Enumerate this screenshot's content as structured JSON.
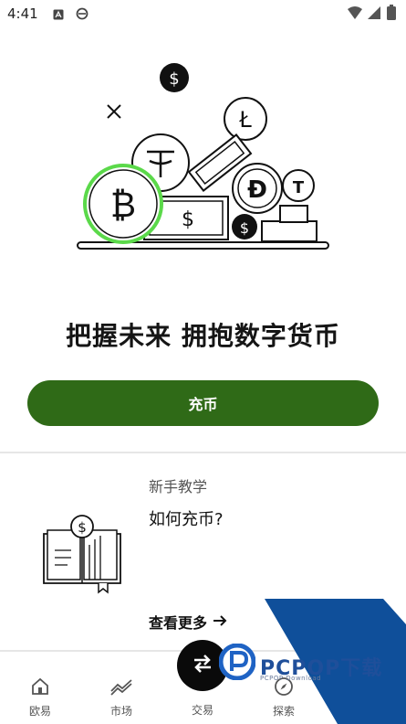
{
  "status_bar": {
    "time": "4:41",
    "icons": [
      "a-box-icon",
      "e-browser-icon",
      "wifi-icon",
      "signal-icon",
      "battery-icon"
    ]
  },
  "hero": {
    "illustration": "crypto-coins-illustration",
    "accent_color": "#5bd94a"
  },
  "headline": "把握未来 拥抱数字货币",
  "cta": {
    "label": "充币",
    "color": "#2f6a17"
  },
  "tutorial": {
    "category": "新手教学",
    "title": "如何充币?",
    "more_label": "查看更多",
    "icon": "book-dollar-icon"
  },
  "watermark": {
    "brand": "PCPOP下载",
    "sub": "PCPOP Download",
    "band_color": "#0f4f9a"
  },
  "bottom_nav": {
    "items": [
      {
        "label": "欧易",
        "icon": "home-icon"
      },
      {
        "label": "市场",
        "icon": "chart-icon"
      },
      {
        "label": "交易",
        "icon": "swap-icon"
      },
      {
        "label": "探索",
        "icon": "compass-icon"
      }
    ]
  }
}
